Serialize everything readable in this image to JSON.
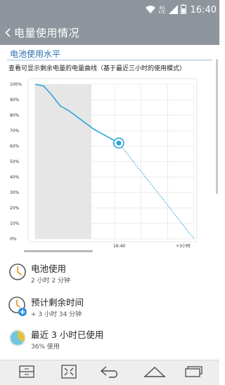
{
  "status": {
    "time": "16:40",
    "network_top": "4G",
    "network_bottom": "LTE"
  },
  "header": {
    "title": "电量使用情况"
  },
  "battery_level": {
    "heading": "电池使用水平",
    "description": "查看可显示剩余电量的电量曲线（基于最近三小时的使用模式）"
  },
  "chart_data": {
    "type": "line",
    "y_ticks": [
      "100%",
      "90%",
      "80%",
      "70%",
      "60%",
      "50%",
      "40%",
      "30%",
      "20%",
      "10%",
      "0%"
    ],
    "ylim": [
      0,
      100
    ],
    "x_labels": [
      "16:40",
      "+3小时"
    ],
    "series": [
      {
        "x": [
          0,
          10,
          20,
          30,
          40,
          50,
          60,
          70,
          80,
          90,
          100
        ],
        "y": [
          100,
          99,
          93,
          86,
          83,
          79,
          75,
          71,
          68,
          65,
          62
        ]
      },
      {
        "x": [
          100,
          190
        ],
        "y": [
          62,
          0
        ]
      }
    ]
  },
  "items": [
    {
      "title": "电池使用",
      "subtitle": "2 小时 2 分钟",
      "icon": "clock-icon"
    },
    {
      "title": "预计剩余时间",
      "subtitle": "+ 3 小时 34 分钟",
      "icon": "clock-plus-icon"
    },
    {
      "title": "最近 3 小时已使用",
      "subtitle": "36% 使用",
      "icon": "pie-icon",
      "used_percent": 36
    }
  ],
  "colors": {
    "bar": "#8e959c",
    "accent": "#2a6fb0",
    "line": "#2aa8d8"
  }
}
